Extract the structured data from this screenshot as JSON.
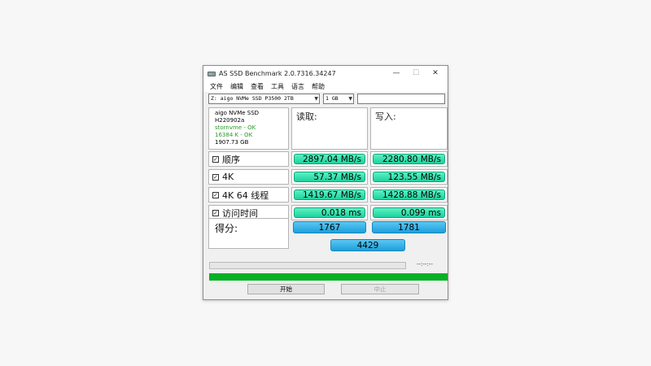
{
  "window": {
    "title": "AS SSD Benchmark 2.0.7316.34247",
    "controls": {
      "minimize": "—",
      "maximize": "☐",
      "close": "✕"
    }
  },
  "menu": [
    "文件",
    "编辑",
    "查看",
    "工具",
    "语言",
    "帮助"
  ],
  "toolbar": {
    "drive": "Z: aigo NVMe SSD P3500 2TB",
    "size": "1 GB",
    "text_value": ""
  },
  "info": {
    "model": "aigo NVMe SSD",
    "firmware": "H220902a",
    "driver": "stornvme - OK",
    "alignment": "16384 K - OK",
    "capacity": "1907.73 GB"
  },
  "headers": {
    "read": "读取:",
    "write": "写入:"
  },
  "rows": [
    {
      "label": "顺序",
      "checked": true,
      "read": "2897.04 MB/s",
      "write": "2280.80 MB/s"
    },
    {
      "label": "4K",
      "checked": true,
      "read": "57.37 MB/s",
      "write": "123.55 MB/s"
    },
    {
      "label": "4K 64 线程",
      "checked": true,
      "read": "1419.67 MB/s",
      "write": "1428.88 MB/s"
    },
    {
      "label": "访问时间",
      "checked": true,
      "read": "0.018 ms",
      "write": "0.099 ms"
    }
  ],
  "score": {
    "label": "得分:",
    "read": "1767",
    "write": "1781",
    "total": "4429"
  },
  "progress": {
    "time": "--:--:--",
    "fraction": 0
  },
  "buttons": {
    "start": "开始",
    "stop": "中止"
  },
  "icons": {
    "app": "hard-disk-icon",
    "checkbox": "checkbox-checked-icon",
    "dropdown": "chevron-down-icon"
  },
  "colors": {
    "result_green": "#1bd39d",
    "score_blue": "#1d9fdb",
    "progress_green": "#06b025"
  }
}
